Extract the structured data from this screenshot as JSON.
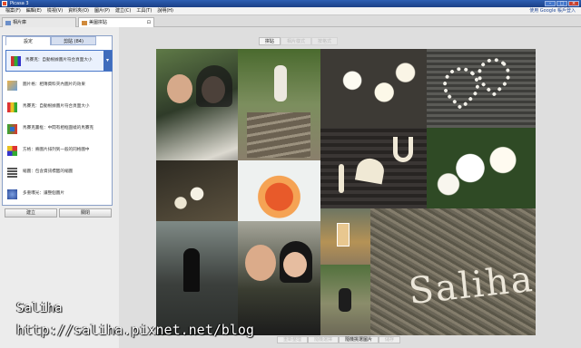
{
  "window": {
    "title": "Picasa 3"
  },
  "menu": [
    "檔案(F)",
    "編輯(E)",
    "檢視(V)",
    "資料夾(O)",
    "圖片(P)",
    "建立(C)",
    "工具(T)",
    "說明(H)"
  ],
  "login_link": "使用 Google 帳戶登入",
  "tabs": [
    {
      "label": "相片庫"
    },
    {
      "label": "美圖拼貼"
    }
  ],
  "panel": {
    "tabs": [
      "設定",
      "剪貼 (84)"
    ],
    "selected": "馬賽克：自動根據圖片符合頁面大小",
    "options": [
      "圖片格：相簿資料夾內圖片的效果",
      "馬賽克：自動根據圖片符合頁面大小",
      "馬賽克畫框：中間有相框圍繞的馬賽克",
      "方格：將圖片排列到一般的同格圖中",
      "縮圖：包含資訊標籤的縮圖",
      "多重曝光：讓整個圖片"
    ],
    "buttons": [
      "建立",
      "關閉"
    ]
  },
  "canvas": {
    "top_controls": [
      "拼貼",
      "相片樣式",
      "按格式"
    ],
    "bottom_controls": [
      "重新整理",
      "隨機選擇",
      "隨機挑選圖片",
      "儲存"
    ]
  },
  "watermark": {
    "name": "Saliha",
    "url": "http://saliha.pixnet.net/blog"
  },
  "colors": {
    "accent": "#3f6cbc",
    "title_bar": "#1b3f86"
  }
}
